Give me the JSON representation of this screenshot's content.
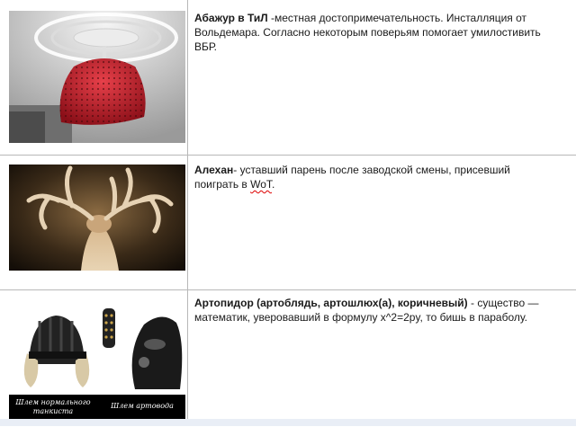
{
  "entries": [
    {
      "term": "Абажур в ТиЛ",
      "definition": " -местная достопримечательность. Инсталляция от Вольдемара. Согласно некоторым поверьям помогает умилостивить ВБР.",
      "image_icon": "lampshade-photo"
    },
    {
      "term": "Алехан",
      "definition": "- уставший парень после заводской смены, присевший поиграть в ",
      "definition_tail": "WoT",
      "definition_end": ".",
      "image_icon": "deer-photo"
    },
    {
      "term": "Артопидор (артоблядь, артошлюх(а), коричневый)",
      "definition": " - существо — математик, уверовавший в формулу x^2=2py, то бишь в параболу.",
      "image_icon": "helmets-photo",
      "caption_left": "Шлем нормального танкиста",
      "caption_right": "Шлем артовода"
    }
  ],
  "colors": {
    "lamp": "#c8202c",
    "border": "#b8b8b8",
    "misspell": "#dd0000"
  }
}
